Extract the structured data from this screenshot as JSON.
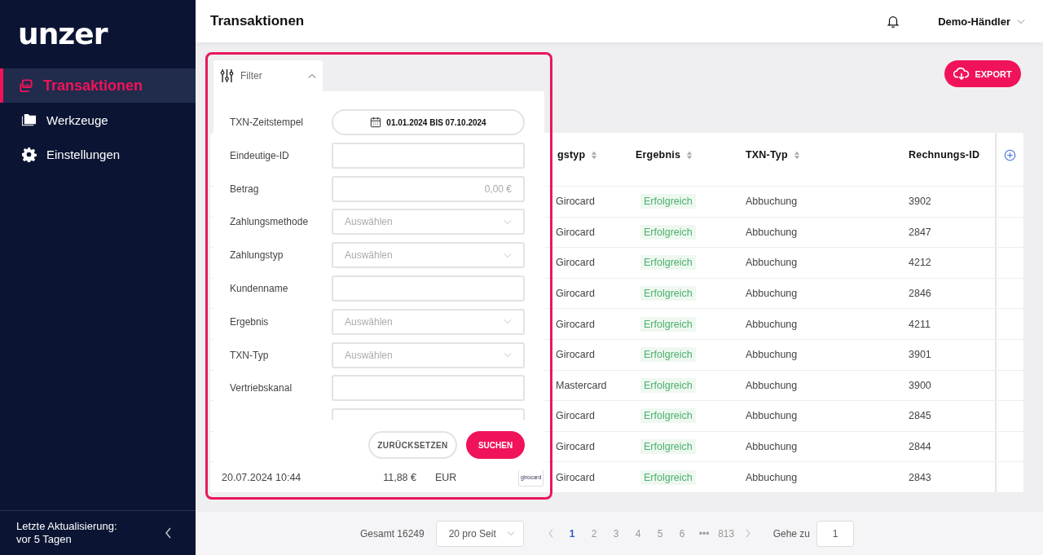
{
  "sidebar": {
    "logo": "unzer",
    "items": [
      {
        "label": "Transaktionen",
        "kind": "transactions",
        "selected": true
      },
      {
        "label": "Werkzeuge",
        "kind": "tools",
        "selected": false
      },
      {
        "label": "Einstellungen",
        "kind": "settings",
        "selected": false
      }
    ],
    "footer": "Letzte Aktualisierung: vor 5 Tagen"
  },
  "header": {
    "title": "Transaktionen",
    "user": "Demo-Händler"
  },
  "export_button": "EXPORT",
  "filter": {
    "tab": "Filter",
    "expanded": true,
    "fields": [
      {
        "label": "TXN-Zeitstempel",
        "kind": "date",
        "value": "01.01.2024 BIS 07.10.2024"
      },
      {
        "label": "Eindeutige-ID",
        "kind": "text"
      },
      {
        "label": "Betrag",
        "kind": "amount",
        "placeholder": "0,00 €"
      },
      {
        "label": "Zahlungsmethode",
        "kind": "select",
        "placeholder": "Auswählen"
      },
      {
        "label": "Zahlungstyp",
        "kind": "select",
        "placeholder": "Auswählen"
      },
      {
        "label": "Kundenname",
        "kind": "text"
      },
      {
        "label": "Ergebnis",
        "kind": "select",
        "placeholder": "Auswählen"
      },
      {
        "label": "TXN-Typ",
        "kind": "select",
        "placeholder": "Auswählen"
      },
      {
        "label": "Vertriebskanal",
        "kind": "text"
      },
      {
        "kind": "text"
      }
    ],
    "reset_button": "ZURÜCKSETZEN",
    "search_button": "SUCHEN"
  },
  "table": {
    "columns": [
      {
        "label": "gstyp",
        "sortable": true
      },
      {
        "label": "Ergebnis",
        "sortable": true
      },
      {
        "label": "TXN-Typ",
        "sortable": true
      },
      {
        "label": "Rechnungs-ID",
        "sortable": false
      }
    ],
    "rows": [
      {
        "payment_type": "Girocard",
        "result": "Erfolgreich",
        "txn_type": "Abbuchung",
        "invoice_id": "3902"
      },
      {
        "payment_type": "Girocard",
        "result": "Erfolgreich",
        "txn_type": "Abbuchung",
        "invoice_id": "2847"
      },
      {
        "payment_type": "Girocard",
        "result": "Erfolgreich",
        "txn_type": "Abbuchung",
        "invoice_id": "4212"
      },
      {
        "payment_type": "Girocard",
        "result": "Erfolgreich",
        "txn_type": "Abbuchung",
        "invoice_id": "2846"
      },
      {
        "payment_type": "Girocard",
        "result": "Erfolgreich",
        "txn_type": "Abbuchung",
        "invoice_id": "4211"
      },
      {
        "payment_type": "Girocard",
        "result": "Erfolgreich",
        "txn_type": "Abbuchung",
        "invoice_id": "3901"
      },
      {
        "payment_type": "Mastercard",
        "result": "Erfolgreich",
        "txn_type": "Abbuchung",
        "invoice_id": "3900"
      },
      {
        "payment_type": "Girocard",
        "result": "Erfolgreich",
        "txn_type": "Abbuchung",
        "invoice_id": "2845"
      },
      {
        "payment_type": "Girocard",
        "result": "Erfolgreich",
        "txn_type": "Abbuchung",
        "invoice_id": "2844"
      },
      {
        "timestamp": "20.07.2024 10:44",
        "amount": "11,88 €",
        "currency": "EUR",
        "method_logo": "girocard",
        "payment_type": "Girocard",
        "result": "Erfolgreich",
        "txn_type": "Abbuchung",
        "invoice_id": "2843"
      }
    ]
  },
  "pagination": {
    "total": "Gesamt 16249",
    "page_size": "20 pro Seit",
    "pages": [
      {
        "label": "1",
        "selected": true
      },
      {
        "label": "2",
        "selected": false
      },
      {
        "label": "3",
        "selected": false
      },
      {
        "label": "4",
        "selected": false
      },
      {
        "label": "5",
        "selected": false
      },
      {
        "label": "6",
        "selected": false
      },
      {
        "label": "•••",
        "selected": false
      },
      {
        "label": "813",
        "selected": false
      }
    ],
    "goto_label": "Gehe zu",
    "goto_value": "1"
  }
}
